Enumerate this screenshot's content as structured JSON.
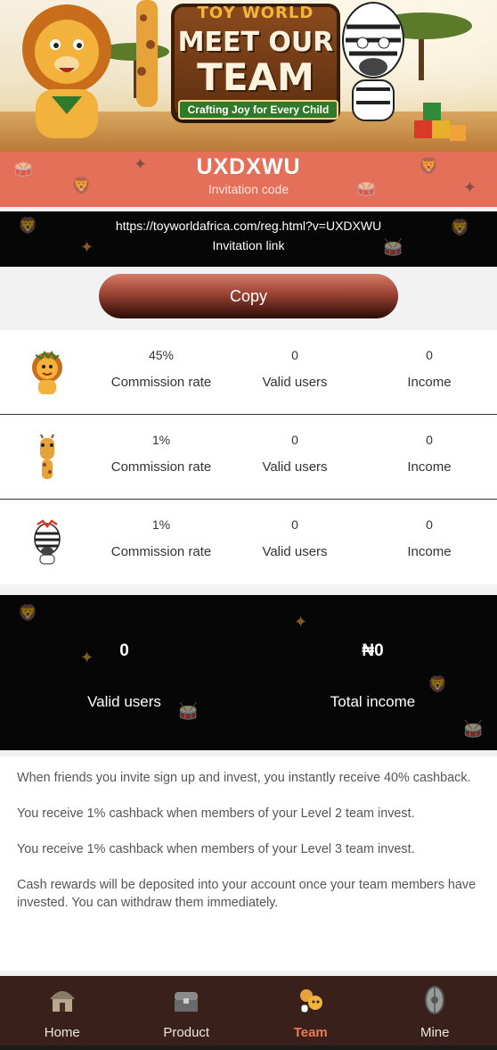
{
  "banner": {
    "brand": "TOY WORLD",
    "title_line1": "MEET OUR",
    "title_line2": "TEAM",
    "tagline": "Crafting Joy for Every Child"
  },
  "invitation": {
    "code": "UXDXWU",
    "code_label": "Invitation code",
    "link": "https://toyworldafrica.com/reg.html?v=UXDXWU",
    "link_label": "Invitation link",
    "copy_label": "Copy"
  },
  "levels": [
    {
      "avatar": "lion-icon",
      "rate": "45%",
      "rate_label": "Commission rate",
      "users": "0",
      "users_label": "Valid users",
      "income": "0",
      "income_label": "Income"
    },
    {
      "avatar": "giraffe-icon",
      "rate": "1%",
      "rate_label": "Commission rate",
      "users": "0",
      "users_label": "Valid users",
      "income": "0",
      "income_label": "Income"
    },
    {
      "avatar": "zebra-icon",
      "rate": "1%",
      "rate_label": "Commission rate",
      "users": "0",
      "users_label": "Valid users",
      "income": "0",
      "income_label": "Income"
    }
  ],
  "totals": {
    "valid_users_value": "0",
    "valid_users_label": "Valid users",
    "total_income_value": "₦0",
    "total_income_label": "Total income"
  },
  "info": [
    "When friends you invite sign up and invest, you instantly receive 40% cashback.",
    "You receive 1% cashback when members of your Level 2 team invest.",
    "You receive 1% cashback when members of your Level 3 team invest.",
    "Cash rewards will be deposited into your account once your team members have invested. You can withdraw them immediately."
  ],
  "tabs": [
    {
      "label": "Home",
      "icon": "hut-icon",
      "active": false
    },
    {
      "label": "Product",
      "icon": "treasure-chest-icon",
      "active": false
    },
    {
      "label": "Team",
      "icon": "animal-team-icon",
      "active": true
    },
    {
      "label": "Mine",
      "icon": "shield-emblem-icon",
      "active": false
    }
  ],
  "colors": {
    "code_strip": "#e5705a",
    "tabbar": "#3a201a",
    "active_tab": "#e87a5a"
  }
}
